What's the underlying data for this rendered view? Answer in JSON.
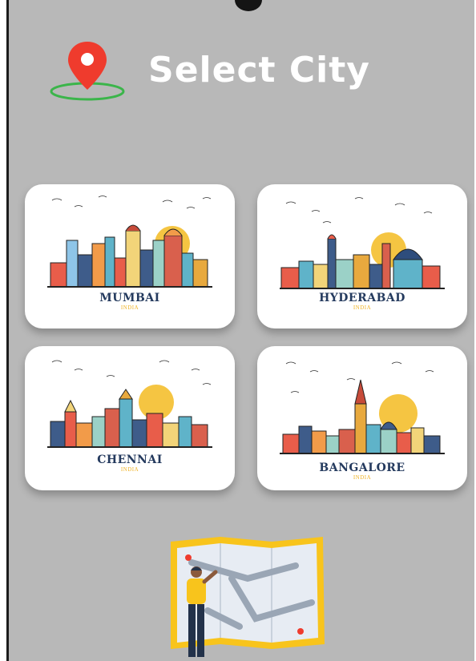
{
  "header": {
    "title": "Select City",
    "icon": "location-pin-icon"
  },
  "cities": [
    {
      "name": "MUMBAI",
      "country": "INDIA"
    },
    {
      "name": "HYDERABAD",
      "country": "INDIA"
    },
    {
      "name": "CHENNAI",
      "country": "INDIA"
    },
    {
      "name": "BANGALORE",
      "country": "INDIA"
    }
  ],
  "colors": {
    "background": "#b8b8b8",
    "card": "#ffffff",
    "title": "#ffffff",
    "pin": "#ef3b2d",
    "pin_ring": "#3bb54a",
    "city_name": "#243a5e",
    "country": "#f0b429",
    "sun": "#f5c542"
  }
}
